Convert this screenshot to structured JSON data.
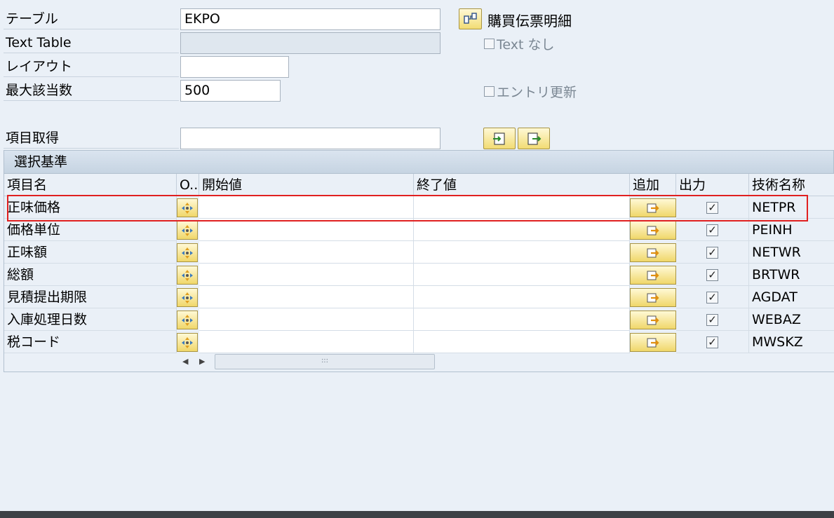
{
  "form": {
    "table_label": "テーブル",
    "table_value": "EKPO",
    "text_table_label": "Text Table",
    "text_table_value": "",
    "layout_label": "レイアウト",
    "layout_value": "",
    "max_hits_label": "最大該当数",
    "max_hits_value": "500",
    "field_get_label": "項目取得",
    "field_get_value": ""
  },
  "table_description": "購買伝票明細",
  "checkboxes": {
    "no_text_label": "Text なし",
    "entry_update_label": "エントリ更新"
  },
  "selection": {
    "title": "選択基準",
    "columns": {
      "field_name": "項目名",
      "option": "O..",
      "low": "開始値",
      "high": "終了値",
      "add": "追加",
      "output": "出力",
      "tech_name": "技術名称"
    },
    "rows": [
      {
        "field": "正味価格",
        "tech": "NETPR",
        "output": true
      },
      {
        "field": "価格単位",
        "tech": "PEINH",
        "output": true
      },
      {
        "field": "正味額",
        "tech": "NETWR",
        "output": true
      },
      {
        "field": "総額",
        "tech": "BRTWR",
        "output": true
      },
      {
        "field": "見積提出期限",
        "tech": "AGDAT",
        "output": true
      },
      {
        "field": "入庫処理日数",
        "tech": "WEBAZ",
        "output": true
      },
      {
        "field": "税コード",
        "tech": "MWSKZ",
        "output": true
      }
    ]
  },
  "colors": {
    "accent_yellow": "#f2dc73",
    "highlight_red": "#e02020",
    "background": "#eaf0f7"
  }
}
